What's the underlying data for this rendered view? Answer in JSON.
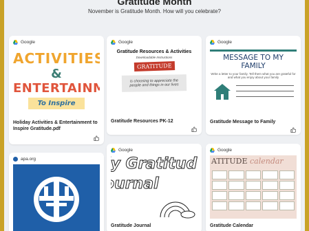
{
  "header": {
    "title": "Gratitude Month",
    "subtitle": "November is Gratitude Month. How will you celebrate?"
  },
  "cards": [
    {
      "source": "Google",
      "caption": "Holiday Activities & Entertainment to Inspire Gratitude.pdf",
      "thumb": {
        "line1": "ACTIVITIES",
        "line2": "&",
        "line3": "ENTERTAINMENT",
        "banner": "To Inspire"
      }
    },
    {
      "source": "Google",
      "caption": "Gratitude Resources PK-12",
      "thumb": {
        "heading": "Gratitude Resources & Activities",
        "subheading": "Downloadable Instructions",
        "tag": "GRATITUDE",
        "note": "is choosing to appreciate the people and things in our lives"
      }
    },
    {
      "source": "Google",
      "caption": "Gratitude Message to Family",
      "thumb": {
        "heading": "MESSAGE TO MY FAMILY",
        "subheading": "Write a letter to your family. Tell them what you are grateful for and what you enjoy about your family"
      }
    },
    {
      "source": "apa.org",
      "caption": "",
      "thumb": {}
    },
    {
      "source": "Google",
      "caption": "Gratitude Journal",
      "thumb": {
        "line1": "ly Gratitud",
        "line2": "ournal"
      }
    },
    {
      "source": "Google",
      "caption": "Gratitude Calendar",
      "thumb": {
        "heading": "ATITUDE",
        "script": "calendar"
      }
    }
  ],
  "colors": {
    "frame": "#c9a227",
    "page_bg": "#eef0f3",
    "apa_blue": "#1f5fa8"
  },
  "icons": {
    "google": "google-drive-icon",
    "apa": "apa-globe-icon",
    "like": "thumbs-up-icon"
  }
}
